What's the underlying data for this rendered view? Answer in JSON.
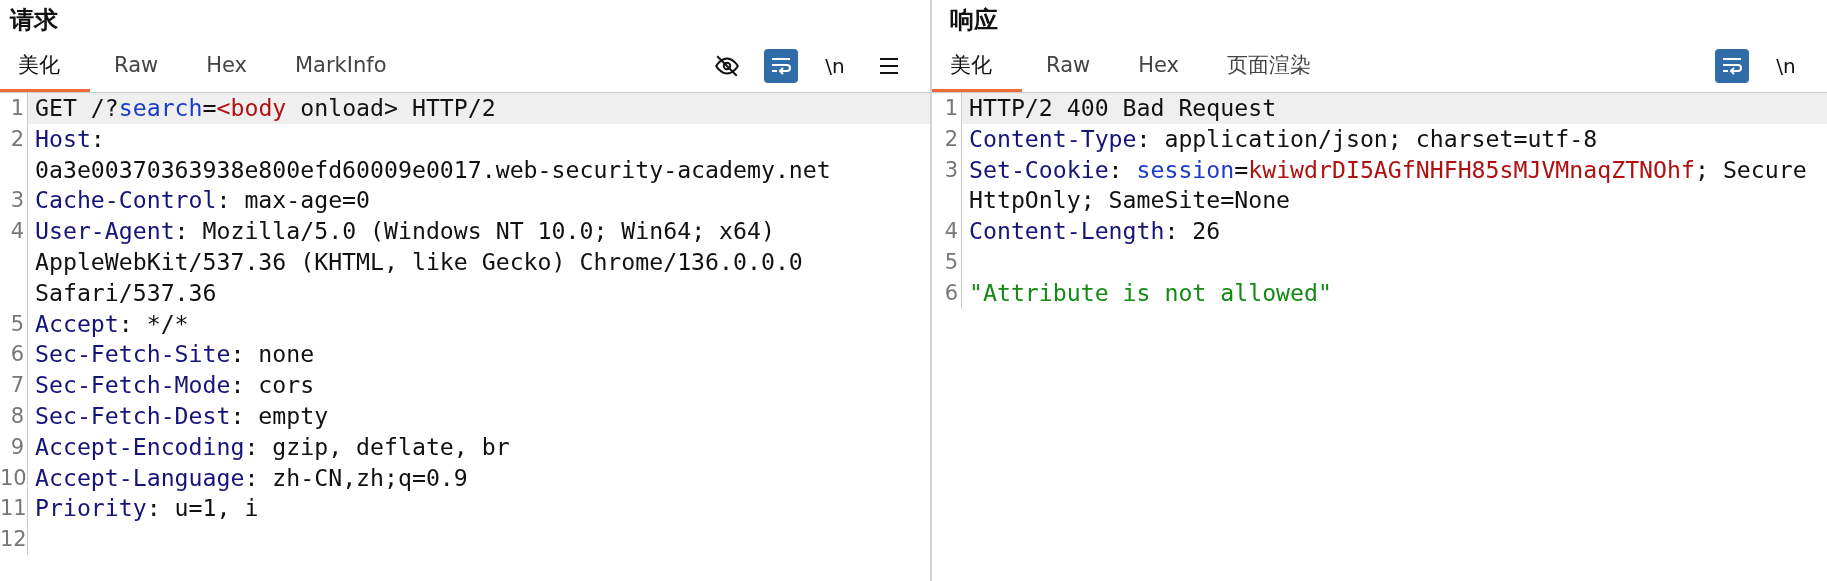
{
  "panels": [
    {
      "title": "请求",
      "tabs": [
        {
          "label": "美化",
          "selected": true
        },
        {
          "label": "Raw",
          "selected": false
        },
        {
          "label": "Hex",
          "selected": false
        },
        {
          "label": "MarkInfo",
          "selected": false
        }
      ],
      "tools": [
        {
          "kind": "hide",
          "on": false
        },
        {
          "kind": "wrap",
          "on": true
        },
        {
          "kind": "text",
          "label": "\\n",
          "on": false
        },
        {
          "kind": "menu",
          "on": false
        }
      ],
      "lines": [
        {
          "number": "1",
          "highlighted": true,
          "rows": [
            [
              {
                "kind": "plain",
                "text": "GET /?"
              },
              {
                "kind": "param",
                "text": "search"
              },
              {
                "kind": "plain",
                "text": "="
              },
              {
                "kind": "red",
                "text": "<body"
              },
              {
                "kind": "plain",
                "text": " onload> HTTP/2"
              }
            ]
          ]
        },
        {
          "number": "2",
          "highlighted": false,
          "rows": [
            [
              {
                "kind": "key",
                "text": "Host"
              },
              {
                "kind": "plain",
                "text": ":"
              }
            ],
            [
              {
                "kind": "plain",
                "text": "0a3e00370363938e800efd60009e0017.web-security-academy.net"
              }
            ]
          ]
        },
        {
          "number": "3",
          "highlighted": false,
          "rows": [
            [
              {
                "kind": "key",
                "text": "Cache-Control"
              },
              {
                "kind": "plain",
                "text": ": max-age=0"
              }
            ]
          ]
        },
        {
          "number": "4",
          "highlighted": false,
          "rows": [
            [
              {
                "kind": "key",
                "text": "User-Agent"
              },
              {
                "kind": "plain",
                "text": ": Mozilla/5.0 (Windows NT 10.0; Win64; x64)"
              }
            ],
            [
              {
                "kind": "plain",
                "text": "AppleWebKit/537.36 (KHTML, like Gecko) Chrome/136.0.0.0"
              }
            ],
            [
              {
                "kind": "plain",
                "text": "Safari/537.36"
              }
            ]
          ]
        },
        {
          "number": "5",
          "highlighted": false,
          "rows": [
            [
              {
                "kind": "key",
                "text": "Accept"
              },
              {
                "kind": "plain",
                "text": ": */*"
              }
            ]
          ]
        },
        {
          "number": "6",
          "highlighted": false,
          "rows": [
            [
              {
                "kind": "key",
                "text": "Sec-Fetch-Site"
              },
              {
                "kind": "plain",
                "text": ": none"
              }
            ]
          ]
        },
        {
          "number": "7",
          "highlighted": false,
          "rows": [
            [
              {
                "kind": "key",
                "text": "Sec-Fetch-Mode"
              },
              {
                "kind": "plain",
                "text": ": cors"
              }
            ]
          ]
        },
        {
          "number": "8",
          "highlighted": false,
          "rows": [
            [
              {
                "kind": "key",
                "text": "Sec-Fetch-Dest"
              },
              {
                "kind": "plain",
                "text": ": empty"
              }
            ]
          ]
        },
        {
          "number": "9",
          "highlighted": false,
          "rows": [
            [
              {
                "kind": "key",
                "text": "Accept-Encoding"
              },
              {
                "kind": "plain",
                "text": ": gzip, deflate, br"
              }
            ]
          ]
        },
        {
          "number": "10",
          "highlighted": false,
          "rows": [
            [
              {
                "kind": "key",
                "text": "Accept-Language"
              },
              {
                "kind": "plain",
                "text": ": zh-CN,zh;q=0.9"
              }
            ]
          ]
        },
        {
          "number": "11",
          "highlighted": false,
          "rows": [
            [
              {
                "kind": "key",
                "text": "Priority"
              },
              {
                "kind": "plain",
                "text": ": u=1, i"
              }
            ]
          ]
        },
        {
          "number": "12",
          "highlighted": false,
          "rows": [
            []
          ]
        }
      ]
    },
    {
      "title": "响应",
      "tabs": [
        {
          "label": "美化",
          "selected": true
        },
        {
          "label": "Raw",
          "selected": false
        },
        {
          "label": "Hex",
          "selected": false
        },
        {
          "label": "页面渲染",
          "selected": false
        }
      ],
      "tools": [
        {
          "kind": "wrap",
          "on": true
        },
        {
          "kind": "text",
          "label": "\\n",
          "on": false
        }
      ],
      "lines": [
        {
          "number": "1",
          "highlighted": true,
          "rows": [
            [
              {
                "kind": "plain",
                "text": "HTTP/2 400 Bad Request"
              }
            ]
          ]
        },
        {
          "number": "2",
          "highlighted": false,
          "rows": [
            [
              {
                "kind": "key",
                "text": "Content-Type"
              },
              {
                "kind": "plain",
                "text": ": application/json; charset=utf-8"
              }
            ]
          ]
        },
        {
          "number": "3",
          "highlighted": false,
          "rows": [
            [
              {
                "kind": "key",
                "text": "Set-Cookie"
              },
              {
                "kind": "plain",
                "text": ": "
              },
              {
                "kind": "param",
                "text": "session"
              },
              {
                "kind": "plain",
                "text": "="
              },
              {
                "kind": "red",
                "text": "kwiwdrDI5AGfNHFH85sMJVMnaqZTNOhf"
              },
              {
                "kind": "plain",
                "text": "; Secure"
              }
            ],
            [
              {
                "kind": "plain",
                "text": "HttpOnly; SameSite=None"
              }
            ]
          ]
        },
        {
          "number": "4",
          "highlighted": false,
          "rows": [
            [
              {
                "kind": "key",
                "text": "Content-Length"
              },
              {
                "kind": "plain",
                "text": ": 26"
              }
            ]
          ]
        },
        {
          "number": "5",
          "highlighted": false,
          "rows": [
            []
          ]
        },
        {
          "number": "6",
          "highlighted": false,
          "rows": [
            [
              {
                "kind": "string",
                "text": "\"Attribute is not allowed\""
              }
            ]
          ]
        }
      ]
    }
  ]
}
